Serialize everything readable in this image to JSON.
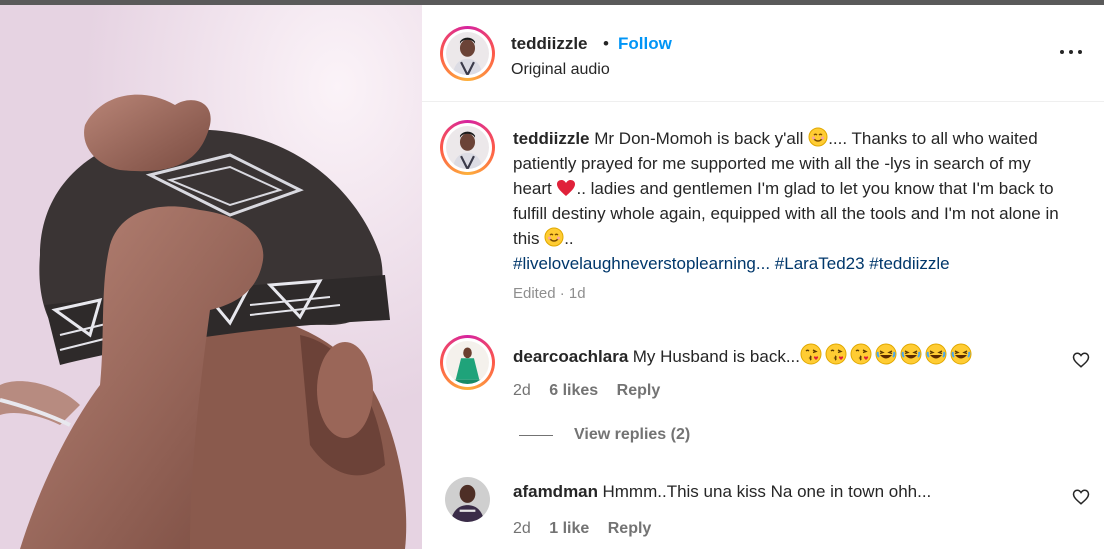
{
  "post": {
    "username": "teddiizzle",
    "separator": "•",
    "follow_label": "Follow",
    "audio": "Original audio"
  },
  "caption": {
    "username": "teddiizzle",
    "part1": "Mr Don-Momoh is back y'all",
    "part2": ".... Thanks to all who waited patiently prayed for me supported me with all the -lys in search of my heart",
    "part3": ".. ladies and gentlemen I'm glad to let you know that I'm back to fulfill destiny whole again, equipped with all the tools and I'm not alone in this",
    "part4": "..",
    "hashtags": "#livelovelaughneverstoplearning... #LaraTed23 #teddiizzle",
    "meta": "Edited · 1d"
  },
  "comments": [
    {
      "username": "dearcoachlara",
      "text": "My Husband is back...",
      "time": "2d",
      "likes": "6 likes",
      "reply": "Reply",
      "emojis": [
        "kissing-face",
        "kissing-face",
        "kissing-face",
        "laughing-face",
        "laughing-face",
        "laughing-face",
        "laughing-face"
      ]
    },
    {
      "username": "afamdman",
      "text": "Hmmm..This una kiss Na one in town ohh...",
      "time": "2d",
      "likes": "1 like",
      "reply": "Reply"
    }
  ],
  "view_replies": "View replies (2)",
  "colors": {
    "link": "#0095f6",
    "hashtag": "#00376b",
    "muted": "#737373"
  }
}
